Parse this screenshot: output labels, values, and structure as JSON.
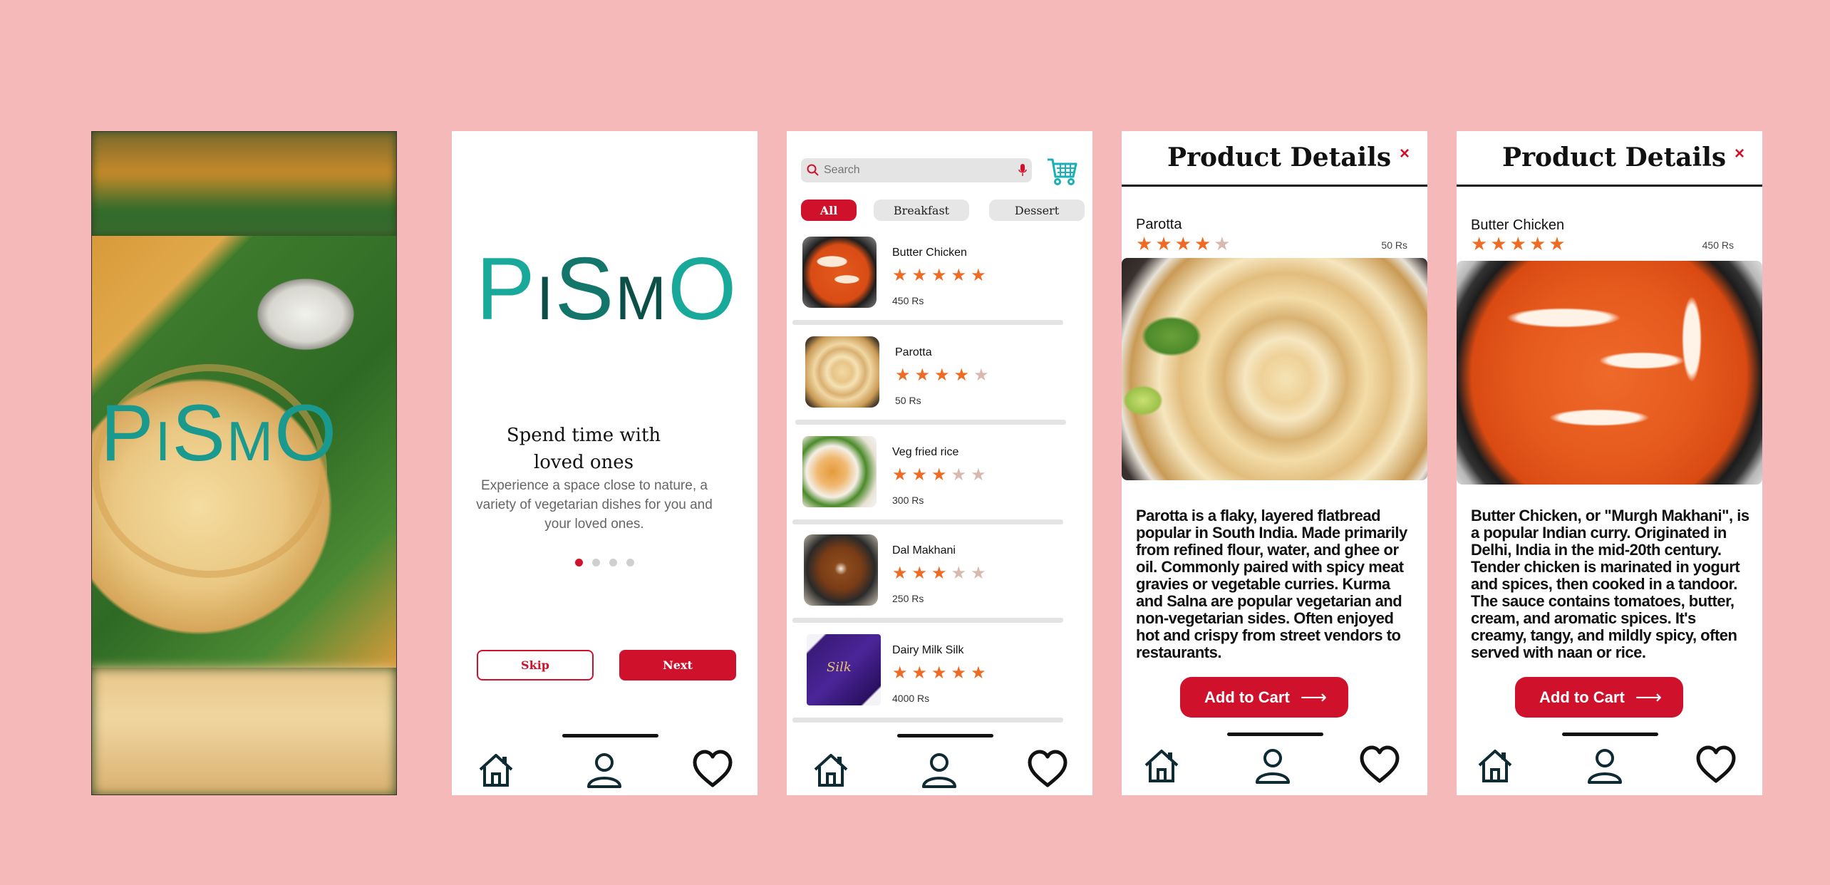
{
  "splash": {
    "logo": {
      "p": "P",
      "i": "I",
      "s": "S",
      "m": "M",
      "o": "O"
    }
  },
  "onboarding": {
    "logo": {
      "p": "P",
      "i": "I",
      "s": "S",
      "m": "M",
      "o": "O"
    },
    "title": "Spend time with loved ones",
    "description": "Experience a space close to nature, a variety of vegetarian dishes for you and your loved ones.",
    "page_indicator": {
      "current": 1,
      "total": 4
    },
    "skip_label": "Skip",
    "next_label": "Next"
  },
  "menu": {
    "search": {
      "placeholder": "Search",
      "value": ""
    },
    "categories": [
      "All",
      "Breakfast",
      "Dessert"
    ],
    "items": [
      {
        "name": "Butter Chicken",
        "rating": 5,
        "price": "450 Rs"
      },
      {
        "name": "Parotta",
        "rating": 4,
        "price": "50 Rs"
      },
      {
        "name": "Veg fried rice",
        "rating": 3,
        "price": "300 Rs"
      },
      {
        "name": "Dal Makhani",
        "rating": 3,
        "price": "250 Rs"
      },
      {
        "name": "Dairy Milk Silk",
        "rating": 5,
        "price": "4000  Rs"
      }
    ],
    "silk_label": "Silk"
  },
  "details_parotta": {
    "header": "Product Details",
    "close": "×",
    "name": "Parotta",
    "rating": 4,
    "price": "50 Rs",
    "description": "Parotta is a flaky, layered flatbread popular in South India. Made primarily from refined flour, water, and ghee or oil. Commonly paired with spicy meat gravies or vegetable curries. Kurma and Salna are popular vegetarian and non-vegetarian sides. Often enjoyed hot and crispy from street vendors to restaurants.",
    "cart_label": "Add to Cart",
    "cart_arrow": "⟶"
  },
  "details_butter": {
    "header": "Product Details",
    "close": "×",
    "name": "Butter Chicken",
    "rating": 5,
    "price": "450 Rs",
    "description": "Butter Chicken, or \"Murgh Makhani\", is a popular Indian curry. Originated in Delhi, India in the mid-20th century. Tender chicken is marinated in yogurt and spices, then cooked in a tandoor. The sauce contains tomatoes, butter, cream, and aromatic spices. It's creamy, tangy, and mildly spicy, often served with naan or rice.",
    "cart_label": "Add to Cart",
    "cart_arrow": "⟶"
  },
  "colors": {
    "accent": "#d0112b",
    "teal": "#19a99a",
    "star": "#ef6a22",
    "background": "#f6b9b9"
  },
  "icons": {
    "home": "home-icon",
    "profile": "profile-icon",
    "favorite": "heart-icon",
    "cart": "cart-icon",
    "search": "search-icon",
    "mic": "mic-icon"
  }
}
